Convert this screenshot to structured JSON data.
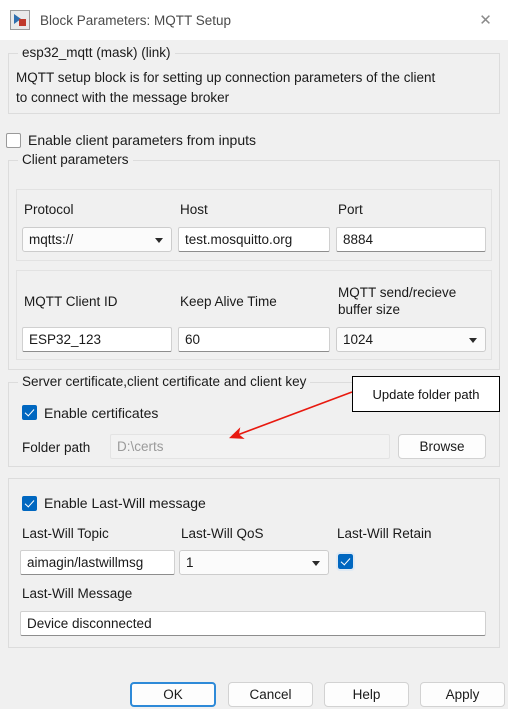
{
  "window": {
    "title": "Block Parameters: MQTT Setup",
    "icon": "simulink-block-icon",
    "close_icon": "✕"
  },
  "header": {
    "mask_title": "esp32_mqtt (mask) (link)",
    "description_line1": "MQTT setup block is for setting up connection parameters of the client",
    "description_line2": "to connect with the message broker"
  },
  "enable_inputs": {
    "label": "Enable client parameters from inputs",
    "checked": false
  },
  "client_parameters": {
    "group_title": "Client parameters",
    "protocol": {
      "label": "Protocol",
      "value": "mqtts://"
    },
    "host": {
      "label": "Host",
      "value": "test.mosquitto.org"
    },
    "port": {
      "label": "Port",
      "value": "8884"
    },
    "client_id": {
      "label": "MQTT Client ID",
      "value": "ESP32_123"
    },
    "keep_alive": {
      "label": "Keep Alive Time",
      "value": "60"
    },
    "buffer_size": {
      "label_line1": "MQTT send/recieve",
      "label_line2": "buffer size",
      "value": "1024"
    }
  },
  "certificates": {
    "group_title": "Server certificate,client certificate and client key",
    "enable_label": "Enable certificates",
    "enable_checked": true,
    "folder_path_label": "Folder path",
    "folder_path_value": "D:\\certs",
    "browse_label": "Browse"
  },
  "last_will": {
    "enable_label": "Enable Last-Will message",
    "enable_checked": true,
    "topic": {
      "label": "Last-Will Topic",
      "value": "aimagin/lastwillmsg"
    },
    "qos": {
      "label": "Last-Will QoS",
      "value": "1"
    },
    "retain": {
      "label": "Last-Will Retain",
      "checked": true
    },
    "message": {
      "label": "Last-Will Message",
      "value": "Device disconnected"
    }
  },
  "annotation": {
    "text": "Update folder path",
    "arrow_color": "#e8190f"
  },
  "footer": {
    "ok": "OK",
    "cancel": "Cancel",
    "help": "Help",
    "apply": "Apply"
  }
}
